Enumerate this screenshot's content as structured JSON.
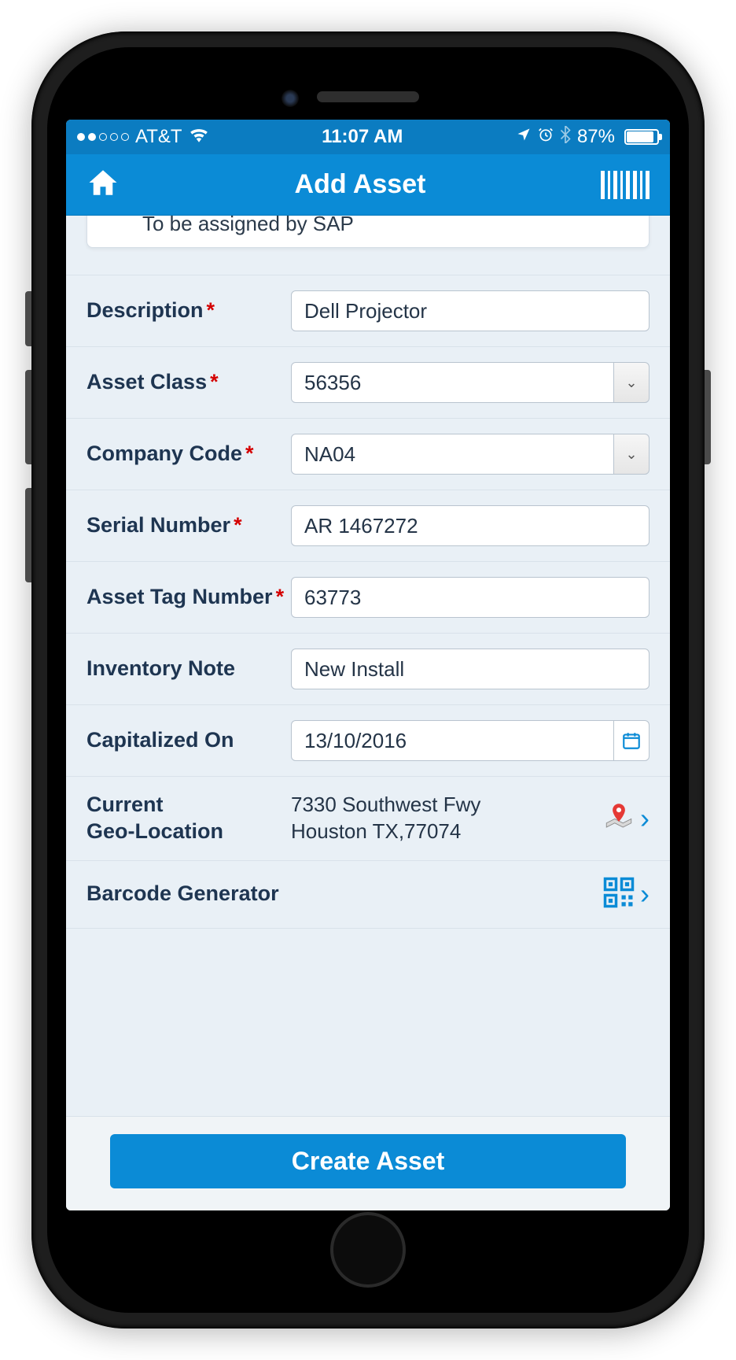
{
  "status": {
    "carrier": "AT&T",
    "time": "11:07 AM",
    "battery_pct": "87%"
  },
  "header": {
    "title": "Add Asset"
  },
  "sap_note": "To be assigned by SAP",
  "fields": {
    "description": {
      "label": "Description",
      "value": "Dell Projector",
      "required": true
    },
    "asset_class": {
      "label": "Asset Class",
      "value": "56356",
      "required": true
    },
    "company_code": {
      "label": "Company Code",
      "value": "NA04",
      "required": true
    },
    "serial_number": {
      "label": "Serial Number",
      "value": "AR 1467272",
      "required": true
    },
    "asset_tag": {
      "label": "Asset Tag Number",
      "value": "63773",
      "required": true
    },
    "inventory_note": {
      "label": "Inventory Note",
      "value": "New Install",
      "required": false
    },
    "capitalized_on": {
      "label": "Capitalized On",
      "value": "13/10/2016",
      "required": false
    },
    "geo": {
      "label": "Current\nGeo-Location",
      "line1": "7330 Southwest Fwy",
      "line2": "Houston TX,77074"
    },
    "barcode_gen": {
      "label": "Barcode Generator"
    }
  },
  "footer": {
    "create_label": "Create Asset"
  }
}
